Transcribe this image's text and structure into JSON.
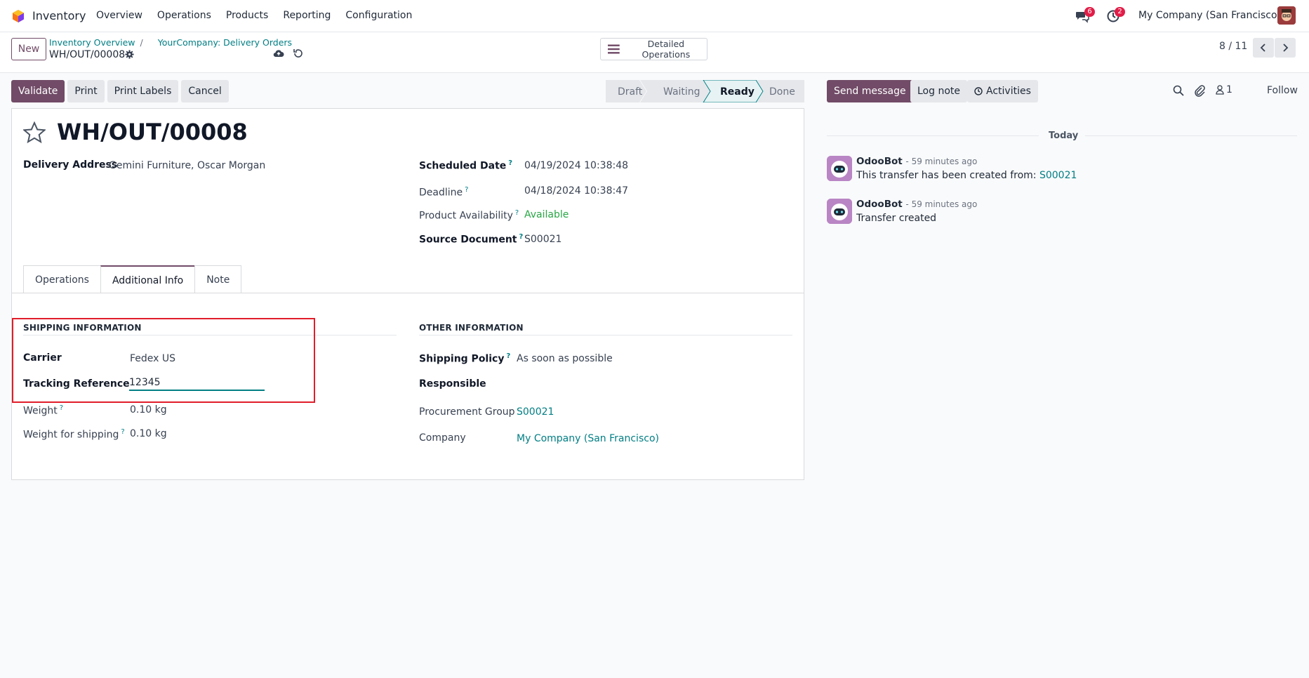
{
  "nav": {
    "app_name": "Inventory",
    "menu": [
      "Overview",
      "Operations",
      "Products",
      "Reporting",
      "Configuration"
    ],
    "chat_badge": "6",
    "activity_badge": "2",
    "company": "My Company (San Francisco)"
  },
  "control": {
    "new_label": "New",
    "breadcrumb": [
      "Inventory Overview",
      "YourCompany: Delivery Orders"
    ],
    "current": "WH/OUT/00008",
    "detailed_ops": "Detailed Operations",
    "pager": "8 / 11"
  },
  "actions": {
    "validate": "Validate",
    "print": "Print",
    "print_labels": "Print Labels",
    "cancel": "Cancel"
  },
  "stages": [
    "Draft",
    "Waiting",
    "Ready",
    "Done"
  ],
  "active_stage": "Ready",
  "form": {
    "name": "WH/OUT/00008",
    "delivery_address_label": "Delivery Address",
    "delivery_address": "Gemini Furniture, Oscar Morgan",
    "scheduled_date_label": "Scheduled Date",
    "scheduled_date": "04/19/2024 10:38:48",
    "deadline_label": "Deadline",
    "deadline": "04/18/2024 10:38:47",
    "availability_label": "Product Availability",
    "availability": "Available",
    "source_label": "Source Document",
    "source": "S00021",
    "tabs": [
      "Operations",
      "Additional Info",
      "Note"
    ],
    "active_tab": "Additional Info",
    "q": "?"
  },
  "shipping": {
    "title": "SHIPPING INFORMATION",
    "carrier_label": "Carrier",
    "carrier": "Fedex US",
    "tracking_label": "Tracking Reference",
    "tracking": "12345",
    "weight_label": "Weight",
    "weight": "0.10 kg",
    "weight_ship_label": "Weight for shipping",
    "weight_ship": "0.10 kg"
  },
  "other": {
    "title": "OTHER INFORMATION",
    "policy_label": "Shipping Policy",
    "policy": "As soon as possible",
    "responsible_label": "Responsible",
    "procurement_label": "Procurement Group",
    "procurement": "S00021",
    "company_label": "Company",
    "company": "My Company (San Francisco)"
  },
  "chatter": {
    "send_message": "Send message",
    "log_note": "Log note",
    "activities": "Activities",
    "followers": "1",
    "follow": "Follow",
    "today": "Today",
    "messages": [
      {
        "author": "OdooBot",
        "time": "- 59 minutes ago",
        "body": "This transfer has been created from:",
        "link": "S00021"
      },
      {
        "author": "OdooBot",
        "time": "- 59 minutes ago",
        "body": "Transfer created",
        "link": ""
      }
    ]
  },
  "colors": {
    "brand": "#714b67",
    "link": "#017e84",
    "badge": "#e11d48",
    "highlight": "#e11d2b"
  }
}
